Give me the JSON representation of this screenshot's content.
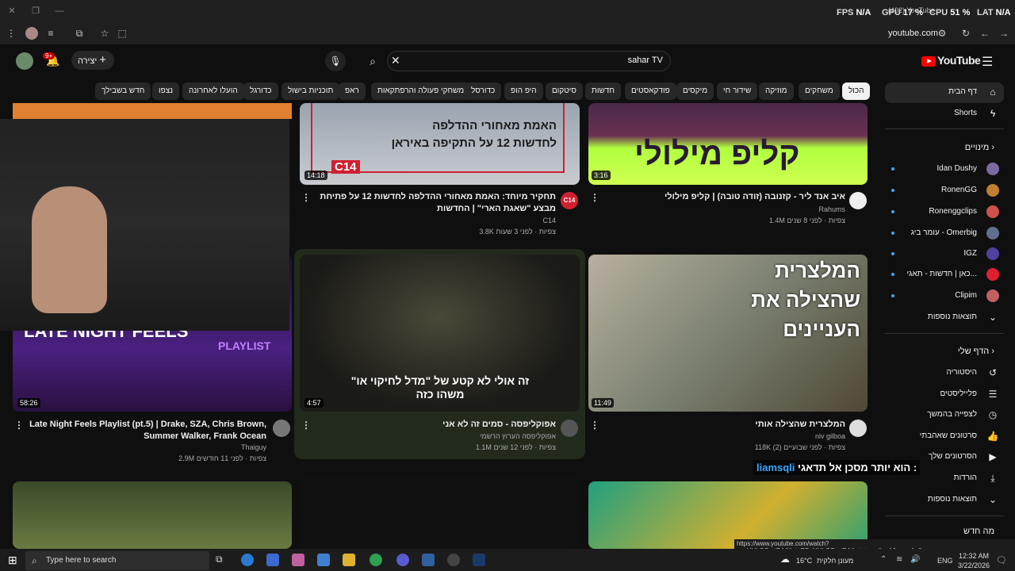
{
  "window": {
    "tab_title": "(402) YouTube",
    "url": "youtube.com"
  },
  "overlay": {
    "fps_label": "FPS",
    "fps_val": "N/A",
    "gpu_label": "GPU",
    "gpu_val": "17 %",
    "cpu_label": "CPU",
    "cpu_val": "51 %",
    "lat_label": "LAT",
    "lat_val": "N/A"
  },
  "header": {
    "logo": "YouTube",
    "search_value": "sahar TV",
    "create_label": "יצירה",
    "notif_count": "9+"
  },
  "chips": [
    "הכול",
    "משחקים",
    "מוזיקה",
    "שידור חי",
    "מיקסים",
    "פודקאסטים",
    "חדשות",
    "סיטקום",
    "היפ הופ",
    "כדורסל",
    "משחקי פעולה והרפתקאות",
    "ראפ",
    "תוכניות בישול",
    "כדורגל",
    "הועלו לאחרונה",
    "נצפו",
    "חדש בשבילך"
  ],
  "sidebar": {
    "home": "דף הבית",
    "shorts": "Shorts",
    "subs_head": "מינויים",
    "subs": [
      "Idan Dushy",
      "RonenGG",
      "Ronenggclips",
      "עומר ביג - Omerbig",
      "IGZ",
      "כאן | חדשות - תאגי...",
      "Clipim"
    ],
    "more1": "תוצאות נוספות",
    "you_head": "הדף שלי",
    "you": [
      "היסטוריה",
      "פלייליסטים",
      "לצפייה בהמשך",
      "סרטונים שאהבתי",
      "הסרטונים שלך",
      "הורדות"
    ],
    "more2": "תוצאות נוספות",
    "whats_new": "מה חדש"
  },
  "videos": {
    "v1": {
      "thumb_text": "קליפ מילולי",
      "duration": "3:16",
      "title": "איב אנד ליר - קזנובה (זודה טובה) | קליפ מילולי",
      "channel": "Rahums",
      "meta": "1.4M צפיות · לפני 8 שנים"
    },
    "v2": {
      "thumb_text1": "האמת מאחורי ההדלפה",
      "thumb_text2": "לחדשות 12 על התקיפה באיראן",
      "badge": "C14",
      "duration": "14:18",
      "title": "תחקיר מיוחד: האמת מאחורי ההדלפה לחדשות 12 על פתיחת מבצע \"שאגת הארי\" | החדשות",
      "channel": "C14",
      "meta": "3.8K צפיות · לפני 3 שעות"
    },
    "v3": {
      "thumb_text1": "המלצרית",
      "thumb_text2": "שהצילה את",
      "thumb_text3": "העניינים",
      "duration": "11:49",
      "title": "המלצרית שהצילה אותי",
      "channel": "niv gilboa",
      "meta": "118K צפיות · לפני שבועיים (2)"
    },
    "v4": {
      "thumb_text": "\"זה אולי לא קטע של \"מדל לחיקוי או משהו כזה",
      "duration": "4:57",
      "title": "אפוקליפסה - סמים זה לא אני",
      "channel": "אפוקליפסה הערוץ הרשמי",
      "meta": "1.1M צפיות · לפני 12 שנים"
    },
    "v5": {
      "thumb_text1": "LATE NIGHT FEELS",
      "thumb_text2": "PLAYLIST",
      "duration": "58:26",
      "title": "Late Night Feels Playlist (pt.5) | Drake, SZA, Chris Brown, Summer Walker, Frank Ocean",
      "channel": "Thaiguy",
      "meta": "2.9M צפיות · לפני 11 חודשים"
    }
  },
  "chat": {
    "user": "liamsqli",
    "msg": "הוא יותר מסכן אל תדאגי :"
  },
  "status_url": "https://www.youtube.com/watch?v=vHUbCCvviBA&list=RDvHUbCCvviBA&start_radio=1&pp=oAc8",
  "taskbar": {
    "search": "Type here to search",
    "weather": "16°C",
    "weather_desc": "מעונן חלקית",
    "lang": "ENG",
    "time": "12:32 AM",
    "date": "3/22/2026"
  }
}
